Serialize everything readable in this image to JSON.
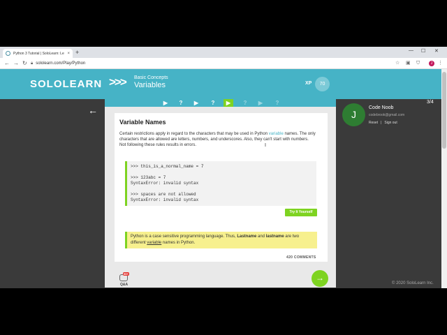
{
  "browser": {
    "tab_title": "Python 3 Tutorial | SoloLearn: Le",
    "tab_close": "×",
    "new_tab": "+",
    "minimize": "—",
    "maximize": "☐",
    "close": "✕",
    "url": "sololearn.com/Play/Python",
    "profile_initial": "J"
  },
  "header": {
    "logo": "SOLOLEARN",
    "chevrons": ">>>",
    "section": "Basic Concepts",
    "lesson": "Variables",
    "xp_label": "XP",
    "xp_value": "70"
  },
  "progress": {
    "steps": [
      {
        "glyph": "▶",
        "state": "done"
      },
      {
        "glyph": "?",
        "state": "done"
      },
      {
        "glyph": "▶",
        "state": "done"
      },
      {
        "glyph": "?",
        "state": "done"
      },
      {
        "glyph": "▶",
        "state": "active"
      },
      {
        "glyph": "?",
        "state": "future"
      },
      {
        "glyph": "▶",
        "state": "future"
      },
      {
        "glyph": "?",
        "state": "future"
      }
    ],
    "count": "3/4"
  },
  "lesson": {
    "title": "Variable Names",
    "para_1a": "Certain restrictions apply in regard to the characters that may be used in Python ",
    "para_1_link": "variable",
    "para_1b": " names. The only characters that are allowed are letters, numbers, and underscores. Also, they can't start with numbers.",
    "para_2": "Not following these rules results in errors.",
    "code": {
      "line1": ">>> this_is_a_normal_name = 7",
      "line2": ">>> 123abc = 7",
      "line3": "SyntaxError: invalid syntax",
      "line4": ">>> spaces are not allowed",
      "line5": "SyntaxError: invalid syntax"
    },
    "try_button": "Try It Yourself",
    "note": {
      "a": "Python is a case sensitive programming language. Thus, ",
      "b1": "Lastname",
      "c": " and ",
      "b2": "lastname",
      "d": " are two different ",
      "u": "variable",
      "e": " names in Python."
    },
    "comments": "420 COMMENTS"
  },
  "footer": {
    "qa_label": "Q&A",
    "qa_badge": "99+",
    "next": "→",
    "copyright": "© 2020 SoloLearn Inc."
  },
  "user": {
    "initial": "J",
    "name": "Code Noob",
    "email": "codebrook@gmail.com",
    "reset": "Reset",
    "sep": "|",
    "signout": "Sign out"
  },
  "colors": {
    "brand": "#46b3c6",
    "accent_green": "#7ed321",
    "avatar": "#2e7d32"
  }
}
